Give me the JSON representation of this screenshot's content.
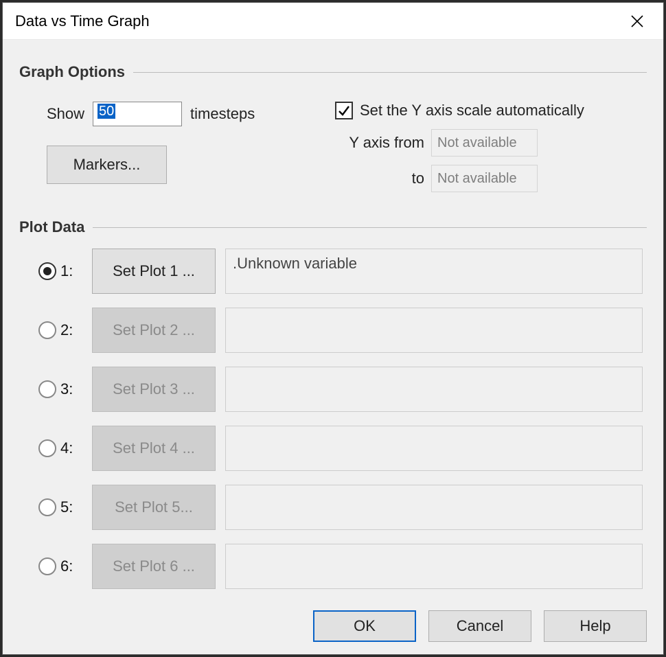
{
  "window": {
    "title": "Data vs Time Graph"
  },
  "graph_options": {
    "heading": "Graph Options",
    "show_label": "Show",
    "show_value": "50",
    "show_unit": "timesteps",
    "markers_button": "Markers...",
    "auto_y_label": "Set the Y axis scale automatically",
    "auto_y_checked": true,
    "y_from_label": "Y axis from",
    "y_from_value": "Not available",
    "y_to_label": "to",
    "y_to_value": "Not available"
  },
  "plot_data": {
    "heading": "Plot Data",
    "rows": [
      {
        "index": "1:",
        "button": "Set Plot 1 ...",
        "value": ".Unknown variable",
        "selected": true,
        "enabled": true
      },
      {
        "index": "2:",
        "button": "Set Plot 2 ...",
        "value": "",
        "selected": false,
        "enabled": false
      },
      {
        "index": "3:",
        "button": "Set Plot 3 ...",
        "value": "",
        "selected": false,
        "enabled": false
      },
      {
        "index": "4:",
        "button": "Set Plot 4 ...",
        "value": "",
        "selected": false,
        "enabled": false
      },
      {
        "index": "5:",
        "button": "Set Plot 5...",
        "value": "",
        "selected": false,
        "enabled": false
      },
      {
        "index": "6:",
        "button": "Set Plot 6 ...",
        "value": "",
        "selected": false,
        "enabled": false
      }
    ]
  },
  "footer": {
    "ok": "OK",
    "cancel": "Cancel",
    "help": "Help"
  }
}
